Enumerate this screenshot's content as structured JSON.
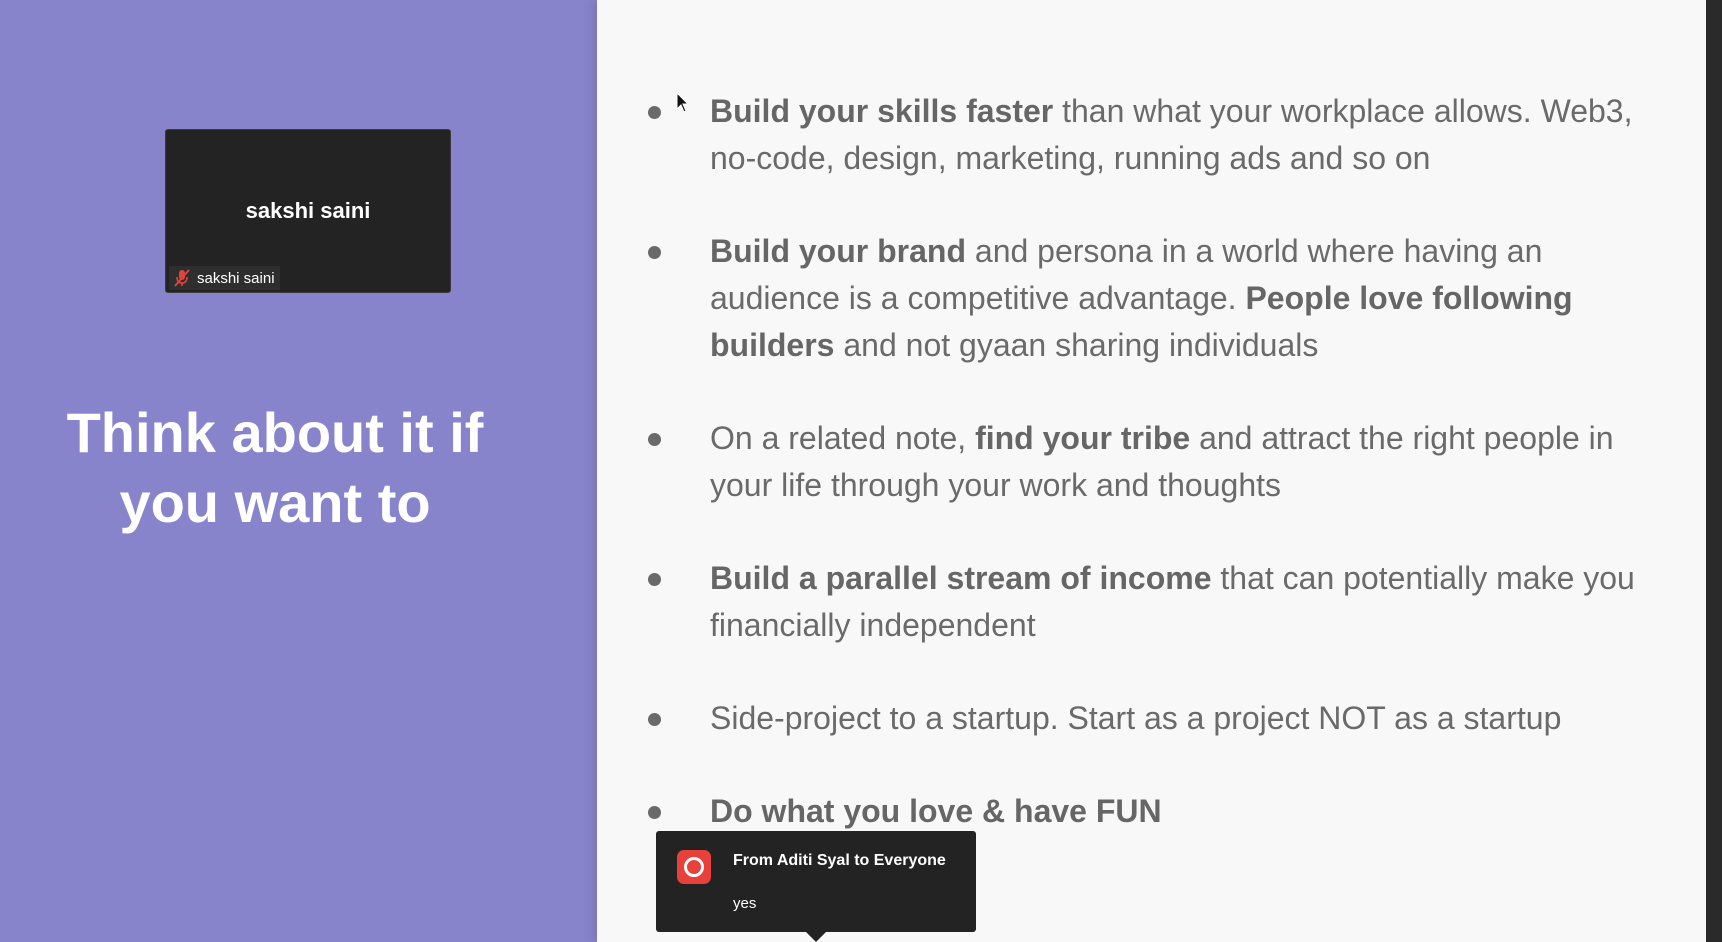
{
  "slide": {
    "title_line1": "Think about it if",
    "title_line2": "you want to",
    "bullets": [
      {
        "segments": [
          {
            "text": "Build your skills faster",
            "bold": true
          },
          {
            "text": " than what your workplace allows. Web3, no-code, design, marketing, running ads and so on",
            "bold": false
          }
        ]
      },
      {
        "segments": [
          {
            "text": "Build your brand",
            "bold": true
          },
          {
            "text": " and persona in a world where having an audience is a competitive advantage. ",
            "bold": false
          },
          {
            "text": "People love following builders",
            "bold": true
          },
          {
            "text": " and not gyaan sharing individuals",
            "bold": false
          }
        ]
      },
      {
        "segments": [
          {
            "text": "On a related note, ",
            "bold": false
          },
          {
            "text": "find your tribe",
            "bold": true
          },
          {
            "text": " and attract the right people in your life through your work and thoughts",
            "bold": false
          }
        ]
      },
      {
        "segments": [
          {
            "text": "Build a parallel stream of income",
            "bold": true
          },
          {
            "text": " that can potentially make you financially independent",
            "bold": false
          }
        ]
      },
      {
        "segments": [
          {
            "text": "Side-project to a startup. Start as a project NOT as a startup",
            "bold": false
          }
        ]
      },
      {
        "segments": [
          {
            "text": "Do what you love & have FUN",
            "bold": true
          }
        ]
      }
    ]
  },
  "video_tile": {
    "participant_name": "sakshi saini",
    "label_name": "sakshi saini",
    "mic_icon": "mic-muted-icon"
  },
  "chat_notification": {
    "from": "From Aditi Syal to Everyone",
    "message": "yes",
    "avatar_icon": "record-icon",
    "avatar_color": "#e8403a"
  },
  "colors": {
    "left_panel": "#8884cc",
    "slide_background": "#f8f8f8",
    "slide_text": "#6a6a6a"
  }
}
